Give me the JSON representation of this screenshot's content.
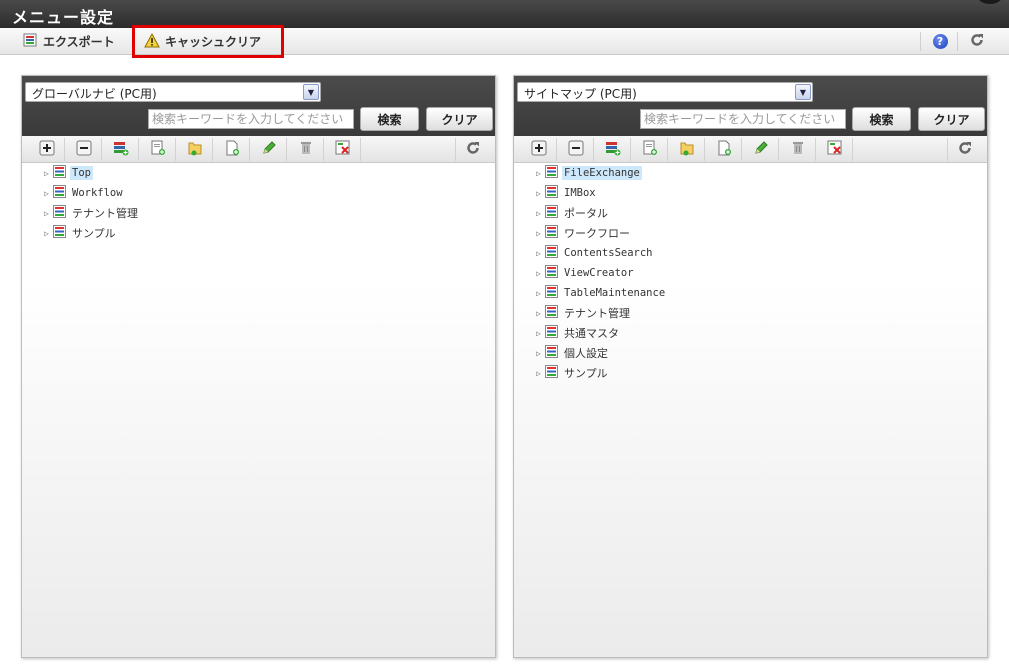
{
  "title": "メニュー設定",
  "toolbar": {
    "export_label": "エクスポート",
    "cache_label": "キャッシュクリア",
    "help_icon": "?"
  },
  "left_panel": {
    "select_value": "グローバルナビ (PC用)",
    "search_placeholder": "検索キーワードを入力してください",
    "search_label": "検索",
    "clear_label": "クリア",
    "items": [
      {
        "label": "Top",
        "selected": true
      },
      {
        "label": "Workflow",
        "selected": false
      },
      {
        "label": "テナント管理",
        "selected": false
      },
      {
        "label": "サンプル",
        "selected": false
      }
    ]
  },
  "right_panel": {
    "select_value": "サイトマップ (PC用)",
    "search_placeholder": "検索キーワードを入力してください",
    "search_label": "検索",
    "clear_label": "クリア",
    "items": [
      {
        "label": "FileExchange",
        "selected": true
      },
      {
        "label": "IMBox",
        "selected": false
      },
      {
        "label": "ポータル",
        "selected": false
      },
      {
        "label": "ワークフロー",
        "selected": false
      },
      {
        "label": "ContentsSearch",
        "selected": false
      },
      {
        "label": "ViewCreator",
        "selected": false
      },
      {
        "label": "TableMaintenance",
        "selected": false
      },
      {
        "label": "テナント管理",
        "selected": false
      },
      {
        "label": "共通マスタ",
        "selected": false
      },
      {
        "label": "個人設定",
        "selected": false
      },
      {
        "label": "サンプル",
        "selected": false
      }
    ]
  },
  "tree_toolbar_icons": [
    "expand-all-icon",
    "collapse-all-icon",
    "add-menu-category-icon",
    "add-page-icon",
    "add-folder-icon",
    "new-document-icon",
    "edit-pencil-icon",
    "delete-trash-icon",
    "delete-selected-icon"
  ],
  "colors": {
    "titlebar": "#333333",
    "highlight_border": "#e00000",
    "selection": "#cde8fb"
  }
}
